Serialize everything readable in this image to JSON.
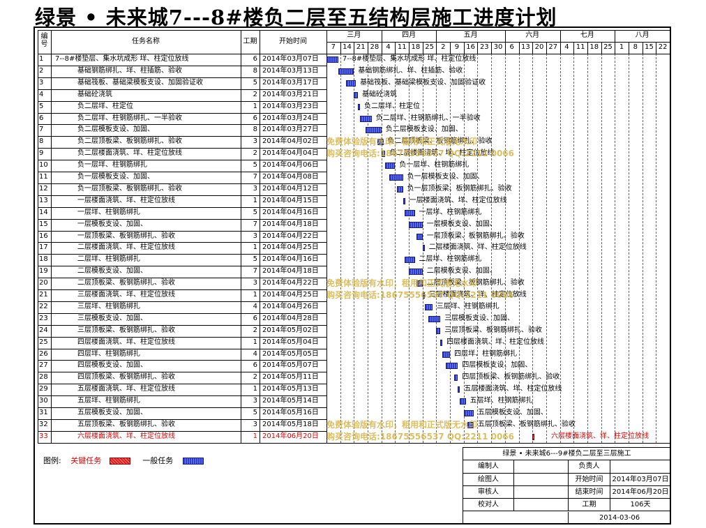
{
  "title": "绿景 • 未来城7---8#楼负二层至五结构层施工进度计划",
  "headers": {
    "no": "编号",
    "task": "任务名称",
    "duration": "工期",
    "start": "开始时间"
  },
  "months": [
    "三月",
    "四月",
    "五月",
    "六月",
    "七月",
    "八月"
  ],
  "days": [
    "7",
    "14",
    "21",
    "28",
    "4",
    "11",
    "18",
    "25",
    "2",
    "9",
    "16",
    "23",
    "30",
    "6",
    "13",
    "20",
    "27",
    "4",
    "11",
    "18",
    "25",
    "1",
    "8",
    "15",
    "22"
  ],
  "tasks": [
    {
      "no": "1",
      "name": "7--8#楼垫层、集水坑成形 垟、柱定位放线",
      "dur": "6",
      "start": "2014年03月07日",
      "crit": false
    },
    {
      "no": "2",
      "name": "基础钢筋绑扎、垟、柱插筋、验收",
      "dur": "8",
      "start": "2014年03月13日",
      "crit": false
    },
    {
      "no": "3",
      "name": "基础筏板、基础梁模板支设、加固验证收",
      "dur": "5",
      "start": "2014年03月17日",
      "crit": false
    },
    {
      "no": "4",
      "name": "基础砼浇筑",
      "dur": "2",
      "start": "2014年03月21日",
      "crit": false
    },
    {
      "no": "5",
      "name": "负二层垟、柱定位",
      "dur": "1",
      "start": "2014年03月23日",
      "crit": false
    },
    {
      "no": "6",
      "name": "负二层垟、柱钢筋绑扎、一半验收",
      "dur": "6",
      "start": "2014年03月24日",
      "crit": false
    },
    {
      "no": "7",
      "name": "负二层模板支设、加固、",
      "dur": "8",
      "start": "2014年03月27日",
      "crit": false
    },
    {
      "no": "8",
      "name": "负二层顶板梁、板钢筋绑扎、验收",
      "dur": "3",
      "start": "2014年04月02日",
      "crit": false
    },
    {
      "no": "9",
      "name": "负二层楼面浇筑、垟、柱定位放线",
      "dur": "2",
      "start": "2014年04月04日",
      "crit": false
    },
    {
      "no": "10",
      "name": "负一层垟、柱钢筋绑扎",
      "dur": "5",
      "start": "2014年04月06日",
      "crit": false
    },
    {
      "no": "11",
      "name": "负一层模板支设、加固、",
      "dur": "7",
      "start": "2014年04月08日",
      "crit": false
    },
    {
      "no": "12",
      "name": "负一层顶板梁、板钢筋绑扎、验收",
      "dur": "3",
      "start": "2014年04月12日",
      "crit": false
    },
    {
      "no": "13",
      "name": "一层楼面浇筑、垟、柱定位放线",
      "dur": "1",
      "start": "2014年04月15日",
      "crit": false
    },
    {
      "no": "14",
      "name": "一层垟、柱钢筋绑扎",
      "dur": "5",
      "start": "2014年04月16日",
      "crit": false
    },
    {
      "no": "15",
      "name": "一层模板支设、加固、",
      "dur": "7",
      "start": "2014年04月18日",
      "crit": false
    },
    {
      "no": "16",
      "name": "一层顶板梁、板钢筋绑扎、验收",
      "dur": "3",
      "start": "2014年04月22日",
      "crit": false
    },
    {
      "no": "17",
      "name": "二层楼面浇筑、垟、柱定位放线",
      "dur": "1",
      "start": "2014年04月25日",
      "crit": false
    },
    {
      "no": "18",
      "name": "二层垟、柱钢筋绑扎",
      "dur": "5",
      "start": "2014年04月16日",
      "crit": false
    },
    {
      "no": "19",
      "name": "二层模板支设、加固、",
      "dur": "7",
      "start": "2014年04月18日",
      "crit": false
    },
    {
      "no": "20",
      "name": "二层顶板梁、板钢筋绑扎、验收",
      "dur": "3",
      "start": "2014年04月22日",
      "crit": false
    },
    {
      "no": "21",
      "name": "三层楼面浇筑、垟、柱定位放线",
      "dur": "1",
      "start": "2014年04月25日",
      "crit": false
    },
    {
      "no": "22",
      "name": "三层垟、柱钢筋绑扎",
      "dur": "4",
      "start": "2014年04月26日",
      "crit": false
    },
    {
      "no": "23",
      "name": "三层模板支设、加固、",
      "dur": "6",
      "start": "2014年04月28日",
      "crit": false
    },
    {
      "no": "24",
      "name": "三层顶板梁、板钢筋绑扎、验收",
      "dur": "2",
      "start": "2014年05月02日",
      "crit": false
    },
    {
      "no": "25",
      "name": "四层楼面浇筑、垟、柱定位放线",
      "dur": "1",
      "start": "2014年05月04日",
      "crit": false
    },
    {
      "no": "26",
      "name": "四层垟、柱钢筋绑扎",
      "dur": "4",
      "start": "2014年05月05日",
      "crit": false
    },
    {
      "no": "27",
      "name": "四层模板支设、加固、",
      "dur": "6",
      "start": "2014年05月07日",
      "crit": false
    },
    {
      "no": "28",
      "name": "四层顶板梁、板钢筋绑扎、验收",
      "dur": "2",
      "start": "2014年05月11日",
      "crit": false
    },
    {
      "no": "29",
      "name": "五层楼面浇筑、垟、柱定位放线",
      "dur": "1",
      "start": "2014年05月13日",
      "crit": false
    },
    {
      "no": "30",
      "name": "五层垟、柱钢筋绑扎",
      "dur": "3",
      "start": "2014年05月14日",
      "crit": false
    },
    {
      "no": "31",
      "name": "五层模板支设、加固、",
      "dur": "5",
      "start": "2014年05月16日",
      "crit": false
    },
    {
      "no": "32",
      "name": "五层顶板梁、板钢筋绑扎、验收",
      "dur": "3",
      "start": "2014年05月18日",
      "crit": false
    },
    {
      "no": "33",
      "name": "六层楼面浇筑、垟、柱定位放线",
      "dur": "1",
      "start": "2014年06月20日",
      "crit": true
    }
  ],
  "watermarks": [
    "免费体验版有水印，租用和正式版无水印",
    "购买咨询电话:18675556537 QQ:2211 0066"
  ],
  "legend": {
    "label": "图例:",
    "critical": "关键任务",
    "normal": "一般任务"
  },
  "info": {
    "project": "绿景 • 未来城6---9#楼负二层至三层施工",
    "editor_label": "编制人",
    "owner_label": "负责人",
    "drawer_label": "绘图人",
    "start_label": "开始时间",
    "start_value": "2014年03月07日",
    "reviewer_label": "审核人",
    "end_label": "结束时间",
    "end_value": "2014年06月20日",
    "checker_label": "校对人",
    "duration_label": "工期",
    "duration_value": "106天",
    "date": "2014-03-06"
  },
  "colors": {
    "critical": "#e02020",
    "normal": "#2f3fcf",
    "watermark": "#d6b347"
  }
}
